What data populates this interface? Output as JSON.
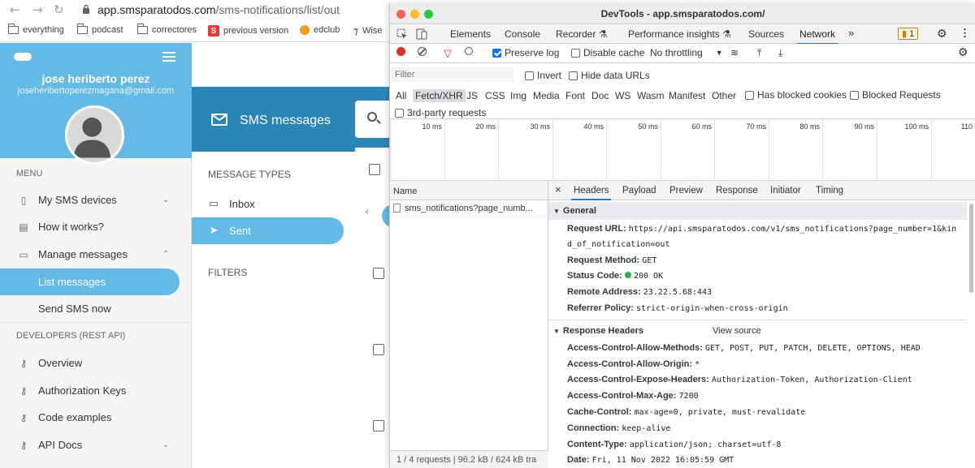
{
  "browser": {
    "url_host": "app.smsparatodos.com",
    "url_path": "/sms-notifications/list/out",
    "bookmarks": [
      {
        "label": "everything",
        "icon": "folder-icon"
      },
      {
        "label": "podcast",
        "icon": "folder-icon"
      },
      {
        "label": "correctores",
        "icon": "folder-icon"
      },
      {
        "label": "previous version",
        "icon": "s-icon"
      },
      {
        "label": "edclub",
        "icon": "edclub-icon"
      },
      {
        "label": "Wise",
        "icon": "wise-icon"
      }
    ]
  },
  "sidebar": {
    "user_name": "jose heriberto perez",
    "user_email": "joseheribertoperezmagana@gmail.com",
    "menu_label": "MENU",
    "items": [
      {
        "label": "My SMS devices",
        "icon": "phone-icon",
        "expand": true
      },
      {
        "label": "How it works?",
        "icon": "document-icon"
      },
      {
        "label": "Manage messages",
        "icon": "message-icon",
        "expand": true
      },
      {
        "label": "List messages"
      },
      {
        "label": "Send SMS now"
      }
    ],
    "developers_label": "DEVELOPERS (REST API)",
    "dev_items": [
      {
        "label": "Overview",
        "icon": "key-icon"
      },
      {
        "label": "Authorization Keys",
        "icon": "key-icon"
      },
      {
        "label": "Code examples",
        "icon": "key-icon"
      },
      {
        "label": "API Docs",
        "icon": "key-icon"
      }
    ]
  },
  "main": {
    "title": "SMS messages",
    "message_types_label": "MESSAGE TYPES",
    "types": [
      {
        "label": "Inbox",
        "icon": "inbox-icon"
      },
      {
        "label": "Sent",
        "icon": "send-icon"
      }
    ],
    "filters_label": "FILTERS"
  },
  "devtools": {
    "title": "DevTools - app.smsparatodos.com/",
    "tabs": [
      "Elements",
      "Console",
      "Recorder",
      "Performance insights",
      "Sources",
      "Network"
    ],
    "active_tab": "Network",
    "issues_count": "1",
    "toolbar": {
      "preserve_log": "Preserve log",
      "disable_cache": "Disable cache",
      "throttling": "No throttling"
    },
    "filter": {
      "placeholder": "Filter",
      "invert": "Invert",
      "hide_data_urls": "Hide data URLs",
      "types": [
        "All",
        "Fetch/XHR",
        "JS",
        "CSS",
        "Img",
        "Media",
        "Font",
        "Doc",
        "WS",
        "Wasm",
        "Manifest",
        "Other"
      ],
      "selected_type": "Fetch/XHR",
      "has_blocked_cookies": "Has blocked cookies",
      "blocked_requests": "Blocked Requests",
      "third_party": "3rd-party requests"
    },
    "timeline_ticks": [
      "10 ms",
      "20 ms",
      "30 ms",
      "40 ms",
      "50 ms",
      "60 ms",
      "70 ms",
      "80 ms",
      "90 ms",
      "100 ms",
      "110"
    ],
    "request_list": {
      "header": "Name",
      "rows": [
        "sms_notifications?page_numb..."
      ],
      "footer": "1 / 4 requests  |  96.2 kB / 624 kB tra"
    },
    "detail_tabs": [
      "Headers",
      "Payload",
      "Preview",
      "Response",
      "Initiator",
      "Timing"
    ],
    "active_detail_tab": "Headers",
    "general": {
      "label": "General",
      "request_url_key": "Request URL:",
      "request_url_line1": "https://api.smsparatodos.com/v1/sms_notifications?page_number=1&kin",
      "request_url_line2": "d_of_notification=out",
      "method_key": "Request Method:",
      "method": "GET",
      "status_key": "Status Code:",
      "status": "200 OK",
      "status_color": "#34a853",
      "remote_key": "Remote Address:",
      "remote": "23.22.5.68:443",
      "referrer_key": "Referrer Policy:",
      "referrer": "strict-origin-when-cross-origin"
    },
    "response_headers": {
      "label": "Response Headers",
      "view_source": "View source",
      "rows": [
        {
          "key": "Access-Control-Allow-Methods:",
          "value": "GET, POST, PUT, PATCH, DELETE, OPTIONS, HEAD"
        },
        {
          "key": "Access-Control-Allow-Origin:",
          "value": "*"
        },
        {
          "key": "Access-Control-Expose-Headers:",
          "value": "Authorization-Token, Authorization-Client"
        },
        {
          "key": "Access-Control-Max-Age:",
          "value": "7200"
        },
        {
          "key": "Cache-Control:",
          "value": "max-age=0, private, must-revalidate"
        },
        {
          "key": "Connection:",
          "value": "keep-alive"
        },
        {
          "key": "Content-Type:",
          "value": "application/json; charset=utf-8"
        },
        {
          "key": "Date:",
          "value": "Fri, 11 Nov 2022 16:05:59 GMT"
        }
      ]
    }
  },
  "colors": {
    "sidebar_accent": "#65b9e5",
    "header_blue": "#2b86b8",
    "devtools_blue": "#1a73e8"
  }
}
